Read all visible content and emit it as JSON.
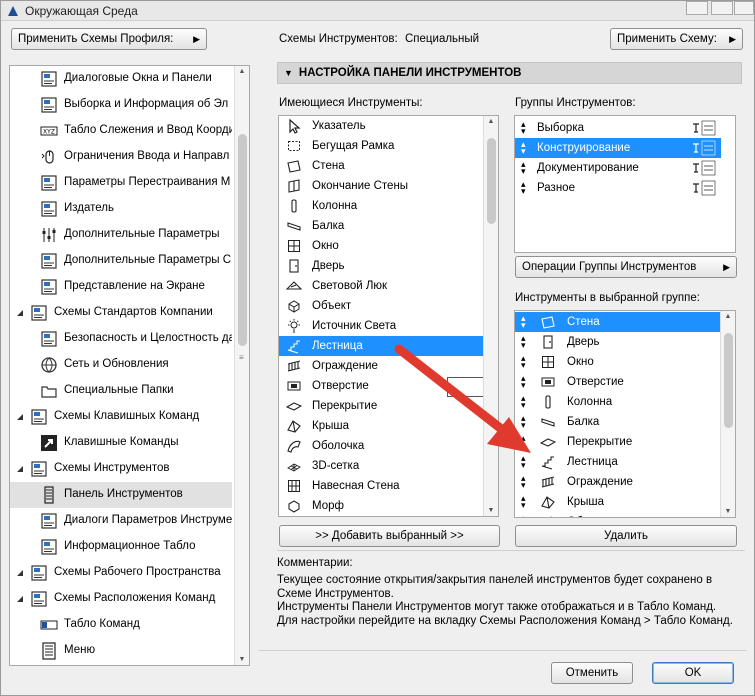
{
  "window": {
    "title": "Окружающая Среда"
  },
  "header": {
    "apply_profile_scheme": "Применить Схемы Профиля:",
    "tool_schemes_label": "Схемы Инструментов:",
    "tool_schemes_value": "Специальный",
    "apply_scheme": "Применить Схему:"
  },
  "tree": {
    "items": [
      {
        "label": "Диалоговые Окна и Панели",
        "icon": "dialog-panels-icon"
      },
      {
        "label": "Выборка и Информация об Эл",
        "icon": "selection-info-icon"
      },
      {
        "label": "Табло Слежения и Ввод Коорди",
        "icon": "xyz-tracker-icon"
      },
      {
        "label": "Ограничения Ввода и Направл",
        "icon": "mouse-constraints-icon"
      },
      {
        "label": "Параметры Перестраивания М",
        "icon": "rebuild-wall-icon"
      },
      {
        "label": "Издатель",
        "icon": "publisher-icon"
      },
      {
        "label": "Дополнительные Параметры",
        "icon": "sliders-icon"
      },
      {
        "label": "Дополнительные Параметры С",
        "icon": "extra-settings-icon"
      },
      {
        "label": "Представление на Экране",
        "icon": "screen-display-icon"
      },
      {
        "label": "Схемы Стандартов Компании",
        "icon": "company-standards-icon"
      },
      {
        "label": "Безопасность и Целостность да",
        "icon": "security-icon"
      },
      {
        "label": "Сеть и Обновления",
        "icon": "globe-icon"
      },
      {
        "label": "Специальные Папки",
        "icon": "folder-icon"
      },
      {
        "label": "Схемы Клавишных Команд",
        "icon": "keyboard-schemes-icon"
      },
      {
        "label": "Клавишные Команды",
        "icon": "shortcut-arrow-icon"
      },
      {
        "label": "Схемы Инструментов",
        "icon": "tool-schemes-icon"
      },
      {
        "label": "Панель Инструментов",
        "icon": "toolbar-icon"
      },
      {
        "label": "Диалоги Параметров Инструме",
        "icon": "tool-settings-icon"
      },
      {
        "label": "Информационное Табло",
        "icon": "info-box-icon"
      },
      {
        "label": "Схемы Рабочего Пространства",
        "icon": "workspace-icon"
      },
      {
        "label": "Схемы Расположения Команд",
        "icon": "command-layout-icon"
      },
      {
        "label": "Табло Команд",
        "icon": "command-board-icon"
      },
      {
        "label": "Меню",
        "icon": "menu-icon"
      }
    ]
  },
  "section": {
    "title": "НАСТРОЙКА ПАНЕЛИ ИНСТРУМЕНТОВ"
  },
  "available": {
    "label": "Имеющиеся Инструменты:",
    "items": [
      {
        "label": "Указатель",
        "icon": "pointer-icon"
      },
      {
        "label": "Бегущая Рамка",
        "icon": "marquee-icon"
      },
      {
        "label": "Стена",
        "icon": "wall-icon"
      },
      {
        "label": "Окончание Стены",
        "icon": "wall-end-icon"
      },
      {
        "label": "Колонна",
        "icon": "column-icon"
      },
      {
        "label": "Балка",
        "icon": "beam-icon"
      },
      {
        "label": "Окно",
        "icon": "window-icon"
      },
      {
        "label": "Дверь",
        "icon": "door-icon"
      },
      {
        "label": "Световой Люк",
        "icon": "skylight-icon"
      },
      {
        "label": "Объект",
        "icon": "object-icon"
      },
      {
        "label": "Источник Света",
        "icon": "lamp-icon"
      },
      {
        "label": "Лестница",
        "icon": "stair-icon"
      },
      {
        "label": "Ограждение",
        "icon": "railing-icon"
      },
      {
        "label": "Отверстие",
        "icon": "opening-icon"
      },
      {
        "label": "Перекрытие",
        "icon": "slab-icon"
      },
      {
        "label": "Крыша",
        "icon": "roof-icon"
      },
      {
        "label": "Оболочка",
        "icon": "shell-icon"
      },
      {
        "label": "3D-сетка",
        "icon": "mesh-icon"
      },
      {
        "label": "Навесная Стена",
        "icon": "curtain-wall-icon"
      },
      {
        "label": "Морф",
        "icon": "morph-icon"
      }
    ],
    "add_button": ">> Добавить выбранный >>"
  },
  "groups": {
    "label": "Группы Инструментов:",
    "items": [
      {
        "label": "Выборка"
      },
      {
        "label": "Конструирование"
      },
      {
        "label": "Документирование"
      },
      {
        "label": "Разное"
      }
    ],
    "operations_button": "Операции Группы Инструментов"
  },
  "group_tools": {
    "label": "Инструменты в выбранной группе:",
    "items": [
      {
        "label": "Стена",
        "icon": "wall-icon"
      },
      {
        "label": "Дверь",
        "icon": "door-icon"
      },
      {
        "label": "Окно",
        "icon": "window-icon"
      },
      {
        "label": "Отверстие",
        "icon": "opening-icon"
      },
      {
        "label": "Колонна",
        "icon": "column-icon"
      },
      {
        "label": "Балка",
        "icon": "beam-icon"
      },
      {
        "label": "Перекрытие",
        "icon": "slab-icon"
      },
      {
        "label": "Лестница",
        "icon": "stair-icon"
      },
      {
        "label": "Ограждение",
        "icon": "railing-icon"
      },
      {
        "label": "Крыша",
        "icon": "roof-icon"
      },
      {
        "label": "Об",
        "icon": "shell-icon"
      }
    ],
    "delete_button": "Удалить"
  },
  "comments": {
    "title": "Комментарии:",
    "line1": "Текущее состояние открытия/закрытия панелей инструментов будет сохранено в",
    "line2": "Схеме Инструментов.",
    "line3": "Инструменты Панели Инструментов могут также отображаться и в Табло Команд.",
    "line4": "Для настройки перейдите на вкладку Схемы Расположения Команд > Табло Команд."
  },
  "footer": {
    "cancel": "Отменить",
    "ok": "OK"
  },
  "colors": {
    "selection": "#1e90ff",
    "annotation_arrow": "#e03a2e"
  }
}
